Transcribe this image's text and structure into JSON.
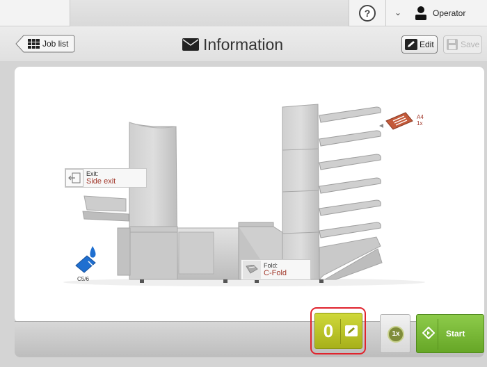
{
  "topbar": {
    "help_icon": "question-circle-icon",
    "operator_dropdown_icon": "chevron-down-icon",
    "user_icon": "user-icon",
    "user_label": "Operator"
  },
  "header": {
    "back_label": "Job list",
    "title": "Information",
    "title_icon": "envelope-icon",
    "edit_label": "Edit",
    "save_label": "Save"
  },
  "machine": {
    "exit_key": "Exit:",
    "exit_value": "Side exit",
    "fold_key": "Fold:",
    "fold_value": "C-Fold",
    "document_size": "A4",
    "document_count": "1x",
    "envelope_size": "C5/6"
  },
  "controls": {
    "counter_value": "0",
    "batch_label": "1x",
    "start_label": "Start"
  },
  "colors": {
    "accent_red": "#a1372a",
    "counter_yellow": "#bfc82c",
    "start_green": "#79b938",
    "highlight_red": "#e0232d"
  }
}
